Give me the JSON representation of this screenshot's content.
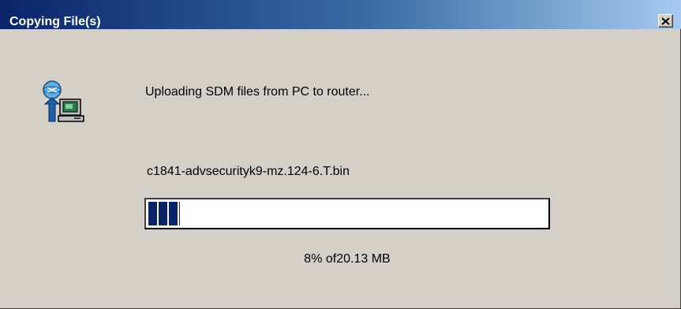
{
  "window": {
    "title": "Copying File(s)",
    "close_symbol": "×"
  },
  "icons": {
    "close": "close-icon",
    "transfer": "pc-to-router-upload-icon"
  },
  "content": {
    "message": "Uploading SDM files from PC to router...",
    "filename": "c1841-advsecurityk9-mz.124-6.T.bin",
    "status": "8% of20.13 MB"
  },
  "progress": {
    "percent": 8,
    "total": "20.13 MB"
  },
  "colors": {
    "title_start": "#0a246a",
    "title_end": "#a6caf0",
    "face": "#d4d0c8",
    "progress_fill": "#0a246a"
  }
}
